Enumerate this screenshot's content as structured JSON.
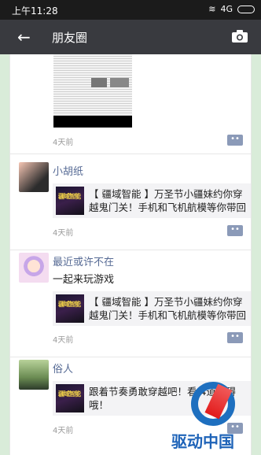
{
  "status_bar": {
    "time": "上午11:28",
    "signal": "4G"
  },
  "navbar": {
    "back_icon": "arrow-left-icon",
    "title": "朋友圈",
    "camera_icon": "camera-icon"
  },
  "posts": [
    {
      "time": "4天前"
    },
    {
      "name": "小胡纸",
      "share_thumb": "疆域智能",
      "share_text": "【 疆域智能 】万圣节小疆妹约你穿越鬼门关！手机和飞机航模等你带回",
      "time": "4天前"
    },
    {
      "name": "最近或许不在",
      "text": "一起来玩游戏",
      "share_thumb": "疆域智能",
      "share_text": "【 疆域智能 】万圣节小疆妹约你穿越鬼门关！手机和飞机航模等你带回",
      "time": "4天前"
    },
    {
      "name": "俗人",
      "share_thumb": "疆域智能",
      "share_text": "跟着节奏勇敢穿越吧！看 4道障碍哦！",
      "time": "4天前"
    }
  ],
  "watermark": {
    "text": "驱动中国"
  },
  "colors": {
    "navbar": "#393a3f",
    "link_name": "#576b95",
    "status": "#1b1b1b"
  }
}
